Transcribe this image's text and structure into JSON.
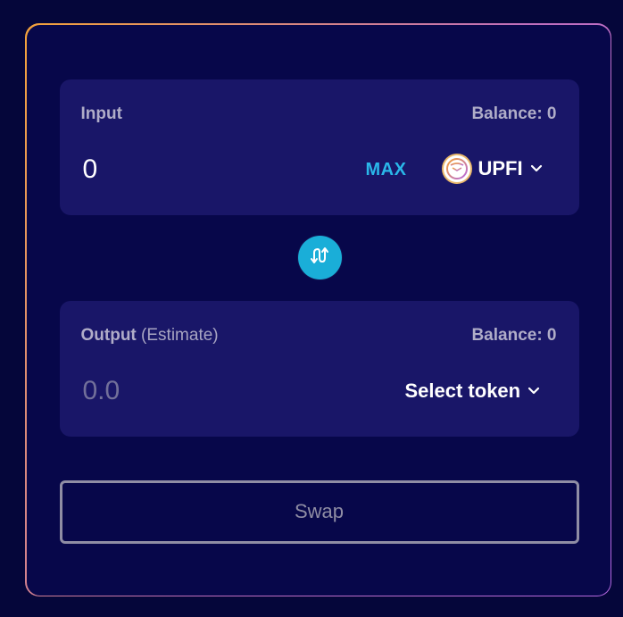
{
  "input_panel": {
    "label": "Input",
    "balance": "Balance: 0",
    "amount": "0",
    "max_label": "MAX",
    "token": {
      "symbol": "UPFI",
      "icon": "upfi-token-icon"
    }
  },
  "swap_direction": {
    "icon": "swap-arrows-icon"
  },
  "output_panel": {
    "label": "Output",
    "label_suffix": "(Estimate)",
    "balance": "Balance: 0",
    "amount_placeholder": "0.0",
    "select_token_label": "Select token"
  },
  "swap_button": {
    "label": "Swap"
  },
  "colors": {
    "background": "#05063a",
    "card": "#07074a",
    "panel": "#191668",
    "accent": "#2ab7e9",
    "swap_circle": "#1aaed8",
    "border_gradient_start": "#f3a23a",
    "border_gradient_end": "#b468e0"
  }
}
